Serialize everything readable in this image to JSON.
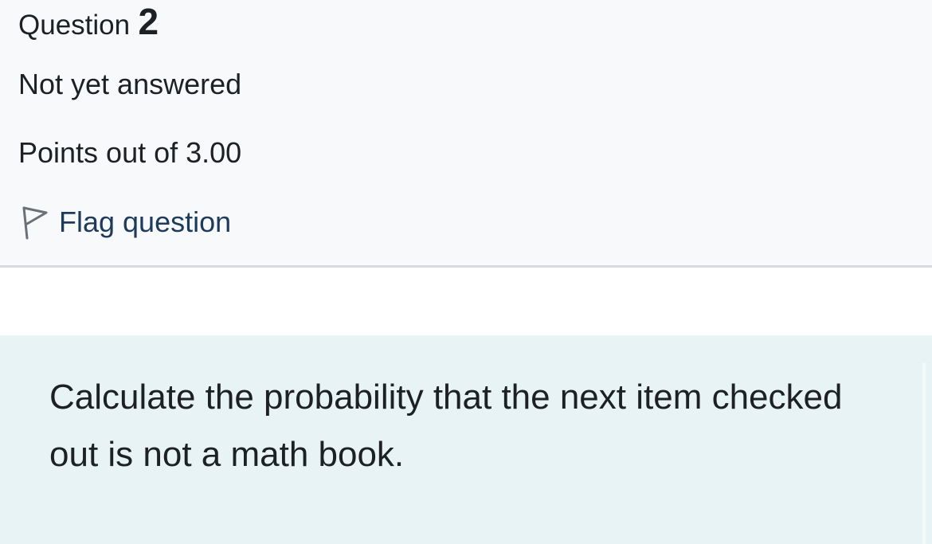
{
  "question": {
    "label": "Question",
    "number": "2",
    "state": "Not yet answered",
    "grade": "Points out of 3.00",
    "flag_label": "Flag question",
    "flag_icon": "flag-icon"
  },
  "formulation": {
    "text": "Calculate the probability that the next item checked out is not a math book."
  },
  "colors": {
    "info_background": "#f8f9fa",
    "formulation_background": "#e7f3f5",
    "text": "#1d2125",
    "link": "#1f3b5a"
  }
}
